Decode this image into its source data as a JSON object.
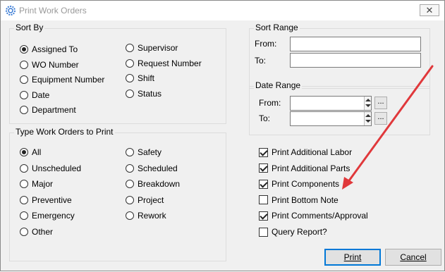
{
  "window": {
    "title": "Print Work Orders",
    "close_glyph": "✕"
  },
  "sort_by": {
    "legend": "Sort By",
    "options": [
      {
        "label": "Assigned To",
        "selected": true
      },
      {
        "label": "WO Number",
        "selected": false
      },
      {
        "label": "Equipment Number",
        "selected": false
      },
      {
        "label": "Date",
        "selected": false
      },
      {
        "label": "Department",
        "selected": false
      },
      {
        "label": "Supervisor",
        "selected": false
      },
      {
        "label": "Request Number",
        "selected": false
      },
      {
        "label": "Shift",
        "selected": false
      },
      {
        "label": "Status",
        "selected": false
      }
    ]
  },
  "sort_range": {
    "legend": "Sort Range",
    "from_label": "From:",
    "to_label": "To:",
    "from_value": "",
    "to_value": ""
  },
  "date_range": {
    "legend": "Date Range",
    "from_label": "From:",
    "to_label": "To:",
    "from_value": "",
    "to_value": "",
    "browse_label": "..."
  },
  "type_work_orders": {
    "legend": "Type Work Orders to Print",
    "options": [
      {
        "label": "All",
        "selected": true
      },
      {
        "label": "Unscheduled",
        "selected": false
      },
      {
        "label": "Major",
        "selected": false
      },
      {
        "label": "Preventive",
        "selected": false
      },
      {
        "label": "Emergency",
        "selected": false
      },
      {
        "label": "Other",
        "selected": false
      },
      {
        "label": "Safety",
        "selected": false
      },
      {
        "label": "Scheduled",
        "selected": false
      },
      {
        "label": "Breakdown",
        "selected": false
      },
      {
        "label": "Project",
        "selected": false
      },
      {
        "label": "Rework",
        "selected": false
      }
    ]
  },
  "print_options": [
    {
      "label": "Print Additional Labor",
      "checked": true
    },
    {
      "label": "Print Additional Parts",
      "checked": true
    },
    {
      "label": "Print Components",
      "checked": true
    },
    {
      "label": "Print Bottom Note",
      "checked": false
    },
    {
      "label": "Print Comments/Approval",
      "checked": true
    },
    {
      "label": "Query Report?",
      "checked": false
    }
  ],
  "buttons": {
    "print": "Print",
    "cancel": "Cancel"
  },
  "annotation": {
    "arrow_color": "#e0383b"
  }
}
